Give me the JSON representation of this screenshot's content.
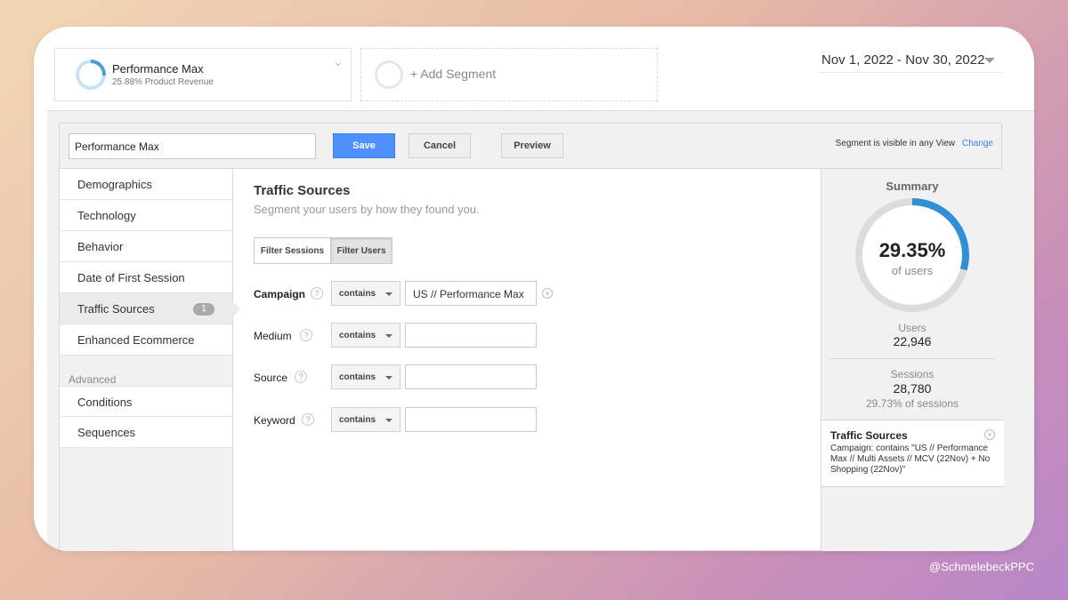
{
  "segments": {
    "active": {
      "name": "Performance Max",
      "subtitle": "25.88% Product Revenue",
      "share_fraction": 0.2588
    },
    "add_label": "+ Add Segment"
  },
  "date_range": "Nov 1, 2022 - Nov 30, 2022",
  "toolbar": {
    "segment_name_value": "Performance Max",
    "save_label": "Save",
    "cancel_label": "Cancel",
    "preview_label": "Preview",
    "visibility_text": "Segment is visible in any View",
    "change_label": "Change"
  },
  "leftnav": {
    "items": [
      {
        "label": "Demographics"
      },
      {
        "label": "Technology"
      },
      {
        "label": "Behavior"
      },
      {
        "label": "Date of First Session"
      },
      {
        "label": "Traffic Sources",
        "badge": "1",
        "active": true
      },
      {
        "label": "Enhanced Ecommerce"
      }
    ],
    "advanced_heading": "Advanced",
    "advanced_items": [
      {
        "label": "Conditions"
      },
      {
        "label": "Sequences"
      }
    ]
  },
  "main": {
    "title": "Traffic Sources",
    "subtitle": "Segment your users by how they found you.",
    "filter_options": [
      "Filter Sessions",
      "Filter Users"
    ],
    "selected_filter": "Filter Users",
    "fields": [
      {
        "label": "Campaign",
        "operator": "contains",
        "value": "US // Performance Max"
      },
      {
        "label": "Medium",
        "operator": "contains",
        "value": ""
      },
      {
        "label": "Source",
        "operator": "contains",
        "value": ""
      },
      {
        "label": "Keyword",
        "operator": "contains",
        "value": ""
      }
    ]
  },
  "summary": {
    "title": "Summary",
    "percent": "29.35%",
    "percent_label": "of users",
    "percent_fraction": 0.2935,
    "users_label": "Users",
    "users_value": "22,946",
    "sessions_label": "Sessions",
    "sessions_value": "28,780",
    "sessions_pct": "29.73% of sessions",
    "condition_title": "Traffic Sources",
    "condition_text": "Campaign: contains \"US // Performance Max // Multi Assets // MCV (22Nov) + No Shopping (22Nov)\""
  },
  "colors": {
    "accent": "#4d90fe",
    "donut": "#2f8fd9"
  },
  "credit": "@SchmelebeckPPC"
}
